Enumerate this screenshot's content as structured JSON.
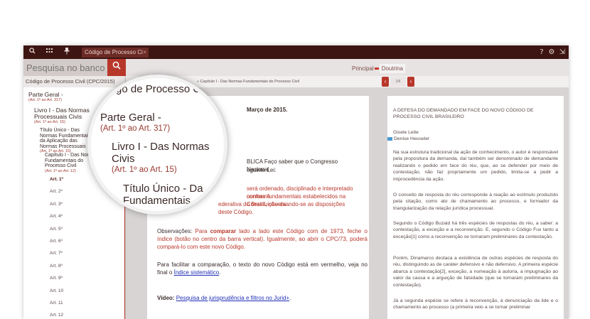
{
  "toolbar": {
    "tab_title": "Código de Processo Ci",
    "tab_close": "×",
    "help": "?",
    "settings": "⚙",
    "logout": "⇲"
  },
  "search": {
    "placeholder": "Pesquisa no banco"
  },
  "view_tabs": {
    "principal": "Principal",
    "doutrina": "Doutrina"
  },
  "sidebar": {
    "header": "Código de Processo Civil (CPC/2015)",
    "tree": [
      {
        "label": "Parte Geral -",
        "sub": "(Art. 1º ao Art. 317)"
      },
      {
        "label": "Livro I - Das Normas Processuais Civis",
        "sub": "(Art. 1º ao Art. 15)"
      },
      {
        "label": "Título Único - Das Normas Fundamentais e da Aplicação das Normas Processuais",
        "sub": "(Art. 1º ao Art. 15)"
      },
      {
        "label": "Capítulo I - Das Normas Fundamentais do Processo Civil",
        "sub": "(Art. 1º ao Art. 12)"
      }
    ],
    "articles": [
      "Art. 1º",
      "Art. 2º",
      "Art. 3º",
      "Art. 4º",
      "Art. 5º",
      "Art. 6º",
      "Art. 7º",
      "Art. 8º",
      "Art. 9º",
      "Art. 10",
      "Art. 11",
      "Art. 12"
    ]
  },
  "breadcrumb": "» Capítulo I - Das Normas Fundamentais do Processo Civil",
  "pager": {
    "prev": "‹",
    "next": "›",
    "page": "1/6"
  },
  "document": {
    "date": "Março de 2015.",
    "pres_a": "BLICA Faço saber que o Congresso Nacional",
    "pres_b": "eguinte Lei:",
    "art1_a": "será ordenado, disciplinado e interpretado conforme",
    "art1_b": "normas fundamentais estabelecidos na Constituição da",
    "art1_c": "ederativa do Brasil, observando-se as disposições deste Código.",
    "obs_label": "Observações:",
    "obs_a": "Para",
    "obs_comparar": "comparar",
    "obs_b": "lado a lado este Código com de 1973, feche o índice (botão no centro da barra vertical). Igualmente, ao abrir o CPC/73, poderá compará-lo com este novo Código.",
    "para_text": "Para facilitar a comparação, o texto do novo Código está em vermelho, veja no final o",
    "para_link": "Índice sistemático",
    "para_end": ".",
    "video_label": "Vídeo:",
    "video_link": "Pesquisa de jurisprudência e filtros no Jurid+",
    "video_end": "."
  },
  "notes": {
    "title": "A DEFESA DO DEMANDADO EM FACE DO NOVO CÓDIGO DE PROCESSO CIVIL BRASILEIRO",
    "author1": "Gisele Leite",
    "author2": "Denise Heuseler",
    "p1": "Na sua estrutura tradicional da ação de conhecimento, o autor é responsável pela propositura da demanda, daí também ser denominado de demandante realizando o pedido em face do réu, que, ao se defender por meio de contestação, não faz propriamente um pedido, limita-se a pedir a improcedência da ação.",
    "p2": "O conceito de resposta do réu corresponde à reação ao estímulo produzido pela citação, como ato de chamamento ao processo, e formador da triangularização da relação jurídica processual.",
    "p3": "Segundo o Código Buzaid há três espécies de respostas do réu, a saber: a contestação, a exceção e a reconvenção. E, segundo o Código Fux tanto a exceção[1] como a reconvenção se tornaram preliminares da contestação.",
    "p4": "Porém, Dinamarco destaca a existência de outras espécies de resposta do réu, distinguindo as de caráter defensivo e não defensivo. A primeira espécie abarca a contestação[2], exceção, a nomeação à autoria, a impugnação ao valor da causa e a arguição de falsidade (que se tornaram preliminares da contestação).",
    "p5": "Já a segunda espécie se refere à reconvenção, à denunciação da lide e o chamamento ao processo (a primeira veio a se tornar preliminar"
  },
  "magnifier": {
    "header": "go de Processo C",
    "parte": "Parte Geral -",
    "parte_sub": "(Art. 1º ao Art. 317)",
    "livro1": "Livro I - Das Normas",
    "livro2": "Civis",
    "livro_sub": "(Art. 1º ao Art. 15)",
    "titulo1": "Título Único - Da",
    "titulo2": "Fundamentais"
  }
}
